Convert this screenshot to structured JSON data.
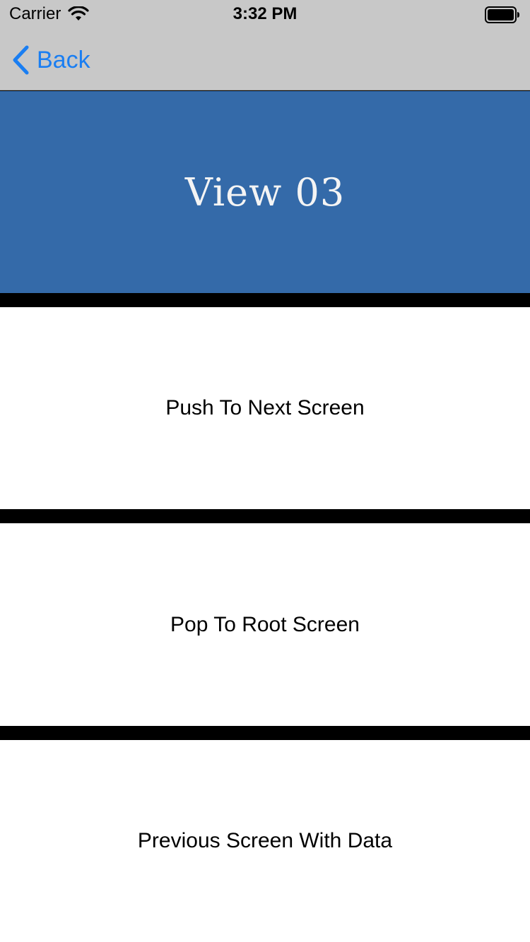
{
  "status_bar": {
    "carrier": "Carrier",
    "time": "3:32 PM",
    "signal_icon": "wifi-icon",
    "battery_icon": "battery-icon"
  },
  "nav_bar": {
    "back_label": "Back",
    "back_icon": "chevron-left-icon",
    "tint_color": "#1a7ef2",
    "background_color": "#c8c8c8"
  },
  "header": {
    "title": "View 03",
    "background_color": "#346aa9"
  },
  "actions": [
    {
      "label": "Push To Next Screen"
    },
    {
      "label": "Pop To Root Screen"
    },
    {
      "label": "Previous Screen With Data"
    }
  ]
}
